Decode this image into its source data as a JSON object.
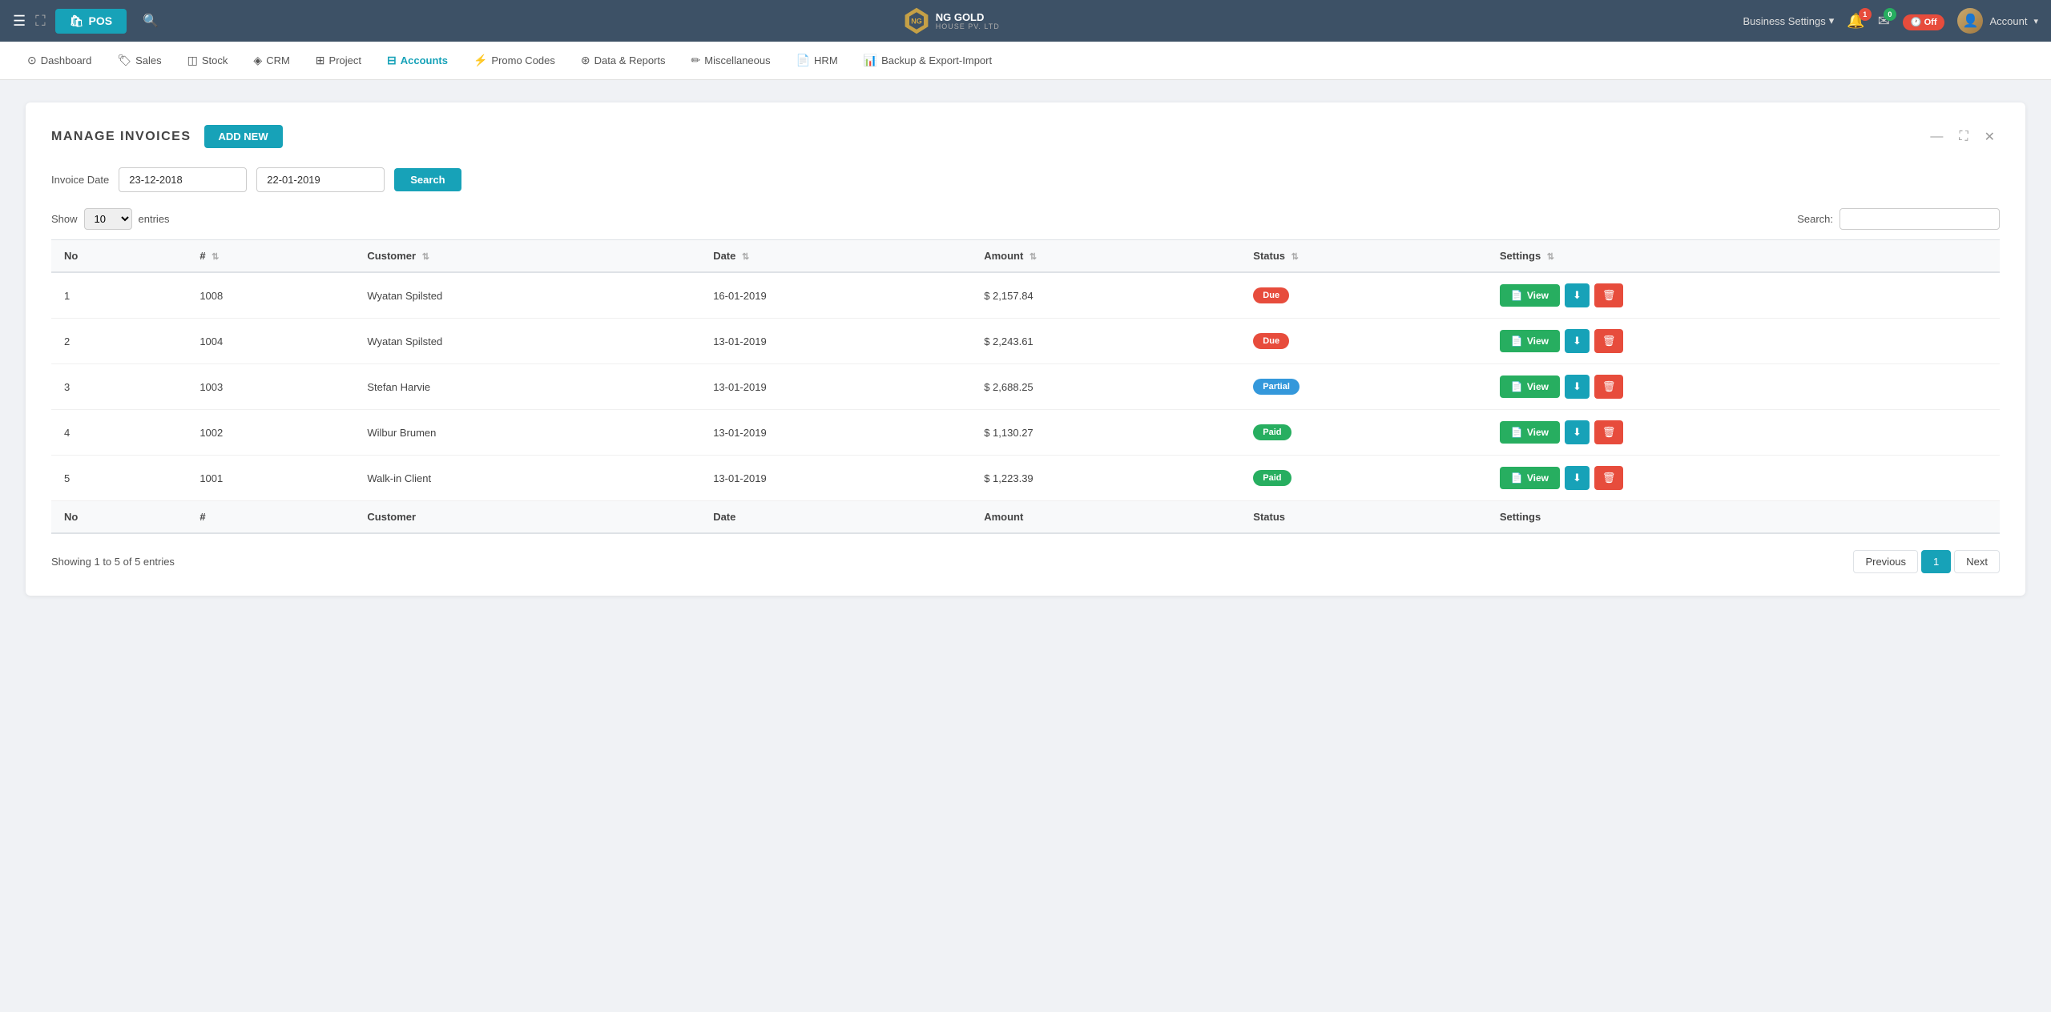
{
  "topnav": {
    "pos_label": "POS",
    "brand_name": "NG GOLD",
    "brand_subtitle": "HOUSE PV. LTD",
    "biz_settings": "Business Settings",
    "account_label": "Account",
    "notif_count": "1",
    "msg_count": "0",
    "timer_label": "Off"
  },
  "mainnav": {
    "items": [
      {
        "id": "dashboard",
        "label": "Dashboard",
        "icon": "⊙"
      },
      {
        "id": "sales",
        "label": "Sales",
        "icon": "🏷"
      },
      {
        "id": "stock",
        "label": "Stock",
        "icon": "◫"
      },
      {
        "id": "crm",
        "label": "CRM",
        "icon": "◈"
      },
      {
        "id": "project",
        "label": "Project",
        "icon": "⊞"
      },
      {
        "id": "accounts",
        "label": "Accounts",
        "icon": "⊟",
        "active": true
      },
      {
        "id": "promo",
        "label": "Promo Codes",
        "icon": "⚡"
      },
      {
        "id": "reports",
        "label": "Data & Reports",
        "icon": "⊛"
      },
      {
        "id": "misc",
        "label": "Miscellaneous",
        "icon": "✏"
      },
      {
        "id": "hrm",
        "label": "HRM",
        "icon": "📄"
      },
      {
        "id": "backup",
        "label": "Backup & Export-Import",
        "icon": "📊"
      }
    ]
  },
  "page": {
    "title": "MANAGE INVOICES",
    "add_new_label": "ADD NEW",
    "invoice_date_label": "Invoice Date",
    "date_from": "23-12-2018",
    "date_to": "22-01-2019",
    "search_btn": "Search",
    "show_label": "Show",
    "entries_label": "entries",
    "entries_value": "10",
    "table_search_label": "Search:",
    "table_search_placeholder": ""
  },
  "table": {
    "headers": [
      {
        "id": "no",
        "label": "No",
        "sortable": false
      },
      {
        "id": "hash",
        "label": "#",
        "sortable": true
      },
      {
        "id": "customer",
        "label": "Customer",
        "sortable": true
      },
      {
        "id": "date",
        "label": "Date",
        "sortable": true
      },
      {
        "id": "amount",
        "label": "Amount",
        "sortable": true
      },
      {
        "id": "status",
        "label": "Status",
        "sortable": true
      },
      {
        "id": "settings",
        "label": "Settings",
        "sortable": true
      }
    ],
    "rows": [
      {
        "no": 1,
        "hash": "1008",
        "customer": "Wyatan Spilsted",
        "date": "16-01-2019",
        "amount": "$ 2,157.84",
        "status": "Due",
        "status_class": "status-due"
      },
      {
        "no": 2,
        "hash": "1004",
        "customer": "Wyatan Spilsted",
        "date": "13-01-2019",
        "amount": "$ 2,243.61",
        "status": "Due",
        "status_class": "status-due"
      },
      {
        "no": 3,
        "hash": "1003",
        "customer": "Stefan Harvie",
        "date": "13-01-2019",
        "amount": "$ 2,688.25",
        "status": "Partial",
        "status_class": "status-partial"
      },
      {
        "no": 4,
        "hash": "1002",
        "customer": "Wilbur Brumen",
        "date": "13-01-2019",
        "amount": "$ 1,130.27",
        "status": "Paid",
        "status_class": "status-paid"
      },
      {
        "no": 5,
        "hash": "1001",
        "customer": "Walk-in Client",
        "date": "13-01-2019",
        "amount": "$ 1,223.39",
        "status": "Paid",
        "status_class": "status-paid"
      }
    ],
    "footer_headers": [
      "No",
      "#",
      "Customer",
      "Date",
      "Amount",
      "Status",
      "Settings"
    ],
    "showing_text": "Showing 1 to 5 of 5 entries"
  },
  "pagination": {
    "previous_label": "Previous",
    "next_label": "Next",
    "current_page": "1"
  },
  "buttons": {
    "view_label": "View",
    "download_icon": "⬇",
    "delete_icon": "🗑"
  }
}
